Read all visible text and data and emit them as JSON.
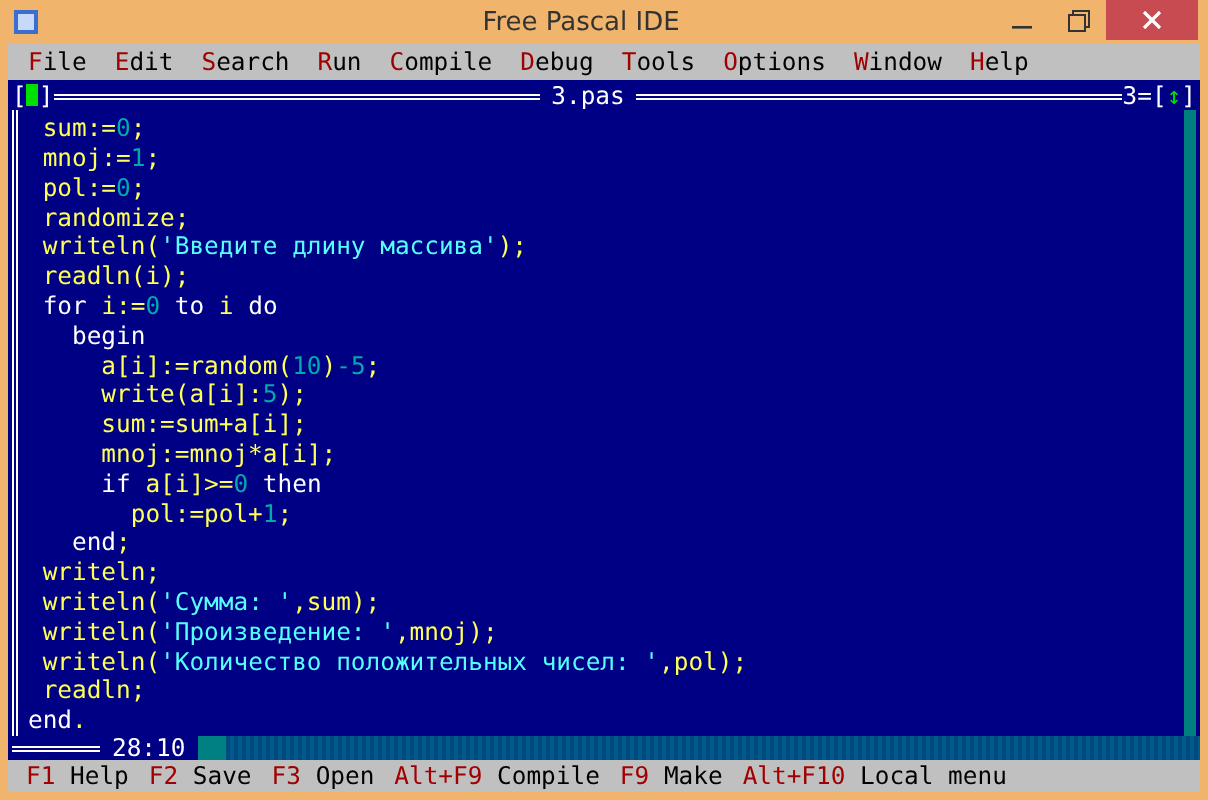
{
  "window": {
    "title": "Free Pascal IDE"
  },
  "menu": [
    {
      "hotkey": "F",
      "rest": "ile"
    },
    {
      "hotkey": "E",
      "rest": "dit"
    },
    {
      "hotkey": "S",
      "rest": "earch"
    },
    {
      "hotkey": "R",
      "rest": "un"
    },
    {
      "hotkey": "C",
      "rest": "ompile"
    },
    {
      "hotkey": "D",
      "rest": "ebug"
    },
    {
      "hotkey": "T",
      "rest": "ools"
    },
    {
      "hotkey": "O",
      "rest": "ptions"
    },
    {
      "hotkey": "W",
      "rest": "indow"
    },
    {
      "hotkey": "H",
      "rest": "elp"
    }
  ],
  "editor": {
    "close_box_left": "[",
    "close_box_right": "]",
    "file_name": "3.pas",
    "window_number": "3=",
    "zoom_box_left": "[",
    "zoom_box_icon": "↕",
    "zoom_box_right": "]",
    "cursor_position": "28:10",
    "lines": [
      [
        {
          "kind": "id",
          "text": " sum:="
        },
        {
          "kind": "num",
          "text": "0"
        },
        {
          "kind": "id",
          "text": ";"
        }
      ],
      [
        {
          "kind": "id",
          "text": " mnoj:="
        },
        {
          "kind": "num",
          "text": "1"
        },
        {
          "kind": "id",
          "text": ";"
        }
      ],
      [
        {
          "kind": "id",
          "text": " pol:="
        },
        {
          "kind": "num",
          "text": "0"
        },
        {
          "kind": "id",
          "text": ";"
        }
      ],
      [
        {
          "kind": "id",
          "text": " randomize;"
        }
      ],
      [
        {
          "kind": "id",
          "text": " writeln("
        },
        {
          "kind": "str",
          "text": "'Введите длину массива'"
        },
        {
          "kind": "id",
          "text": ");"
        }
      ],
      [
        {
          "kind": "id",
          "text": " readln(i);"
        }
      ],
      [
        {
          "kind": "kw",
          "text": " for"
        },
        {
          "kind": "id",
          "text": " i:="
        },
        {
          "kind": "num",
          "text": "0"
        },
        {
          "kind": "kw",
          "text": " to"
        },
        {
          "kind": "id",
          "text": " i"
        },
        {
          "kind": "kw",
          "text": " do"
        }
      ],
      [
        {
          "kind": "kw",
          "text": "   begin"
        }
      ],
      [
        {
          "kind": "id",
          "text": "     a[i]:=random("
        },
        {
          "kind": "num",
          "text": "10"
        },
        {
          "kind": "id",
          "text": ")"
        },
        {
          "kind": "num",
          "text": "-5"
        },
        {
          "kind": "id",
          "text": ";"
        }
      ],
      [
        {
          "kind": "id",
          "text": "     write(a[i]:"
        },
        {
          "kind": "num",
          "text": "5"
        },
        {
          "kind": "id",
          "text": ");"
        }
      ],
      [
        {
          "kind": "id",
          "text": "     sum:=sum+a[i];"
        }
      ],
      [
        {
          "kind": "id",
          "text": "     mnoj:=mnoj*a[i];"
        }
      ],
      [
        {
          "kind": "kw",
          "text": "     if"
        },
        {
          "kind": "id",
          "text": " a[i]>="
        },
        {
          "kind": "num",
          "text": "0"
        },
        {
          "kind": "kw",
          "text": " then"
        }
      ],
      [
        {
          "kind": "id",
          "text": "       pol:=pol+"
        },
        {
          "kind": "num",
          "text": "1"
        },
        {
          "kind": "id",
          "text": ";"
        }
      ],
      [
        {
          "kind": "kw",
          "text": "   end"
        },
        {
          "kind": "id",
          "text": ";"
        }
      ],
      [
        {
          "kind": "id",
          "text": " writeln;"
        }
      ],
      [
        {
          "kind": "id",
          "text": " writeln("
        },
        {
          "kind": "str",
          "text": "'Сумма: '"
        },
        {
          "kind": "id",
          "text": ",sum);"
        }
      ],
      [
        {
          "kind": "id",
          "text": " writeln("
        },
        {
          "kind": "str",
          "text": "'Произведение: '"
        },
        {
          "kind": "id",
          "text": ",mnoj);"
        }
      ],
      [
        {
          "kind": "id",
          "text": " writeln("
        },
        {
          "kind": "str",
          "text": "'Количество положительных чисел: '"
        },
        {
          "kind": "id",
          "text": ",pol);"
        }
      ],
      [
        {
          "kind": "id",
          "text": " readln;"
        }
      ],
      [
        {
          "kind": "kw",
          "text": "end"
        },
        {
          "kind": "id",
          "text": "."
        }
      ]
    ]
  },
  "status_bar": [
    {
      "key": "F1",
      "label": "Help"
    },
    {
      "key": "F2",
      "label": "Save"
    },
    {
      "key": "F3",
      "label": "Open"
    },
    {
      "key": "Alt+F9",
      "label": "Compile"
    },
    {
      "key": "F9",
      "label": "Make"
    },
    {
      "key": "Alt+F10",
      "label": "Local menu"
    }
  ]
}
